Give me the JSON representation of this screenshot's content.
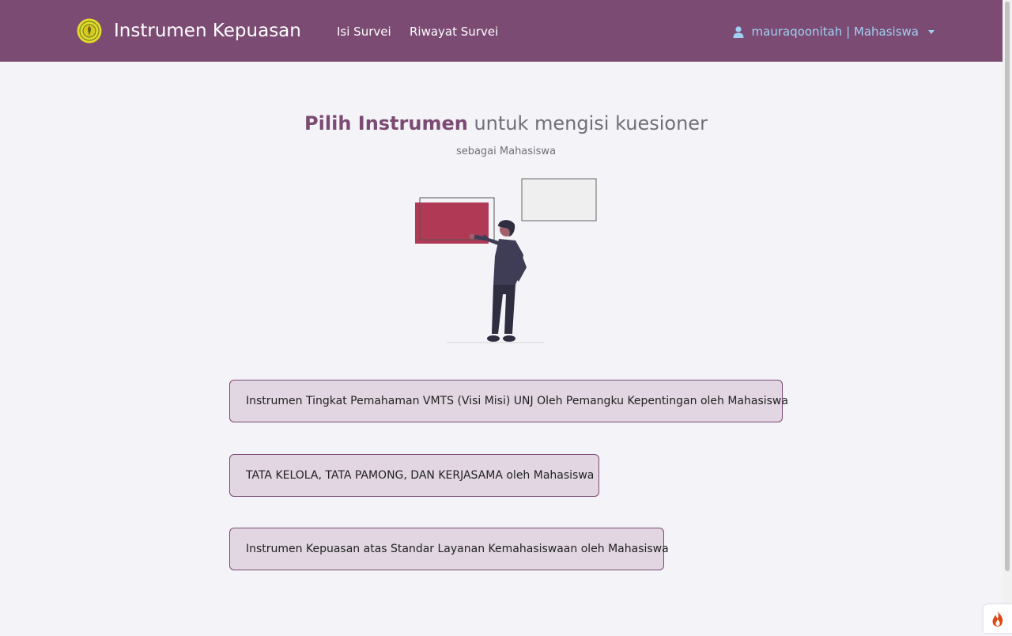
{
  "navbar": {
    "title": "Instrumen Kepuasan",
    "links": [
      "Isi Survei",
      "Riwayat Survei"
    ],
    "user_label": "mauraqoonitah | Mahasiswa",
    "logo_icon": "university-seal-logo",
    "user_icon": "user-icon"
  },
  "page": {
    "heading_emphasis": "Pilih Instrumen",
    "heading_rest": "untuk mengisi kuesioner",
    "subtitle": "sebagai Mahasiswa"
  },
  "instruments": [
    "Instrumen Tingkat Pemahaman VMTS (Visi Misi) UNJ Oleh Pemangku Kepentingan oleh Mahasiswa",
    "TATA KELOLA, TATA PAMONG, DAN KERJASAMA oleh Mahasiswa",
    "Instrumen Kepuasan atas Standar Layanan Kemahasiswaan oleh Mahasiswa"
  ],
  "colors": {
    "primary": "#7b4b74",
    "button_bg": "#e1d6e2",
    "user_link": "#9fd1f2",
    "background": "#f4f3f8"
  }
}
